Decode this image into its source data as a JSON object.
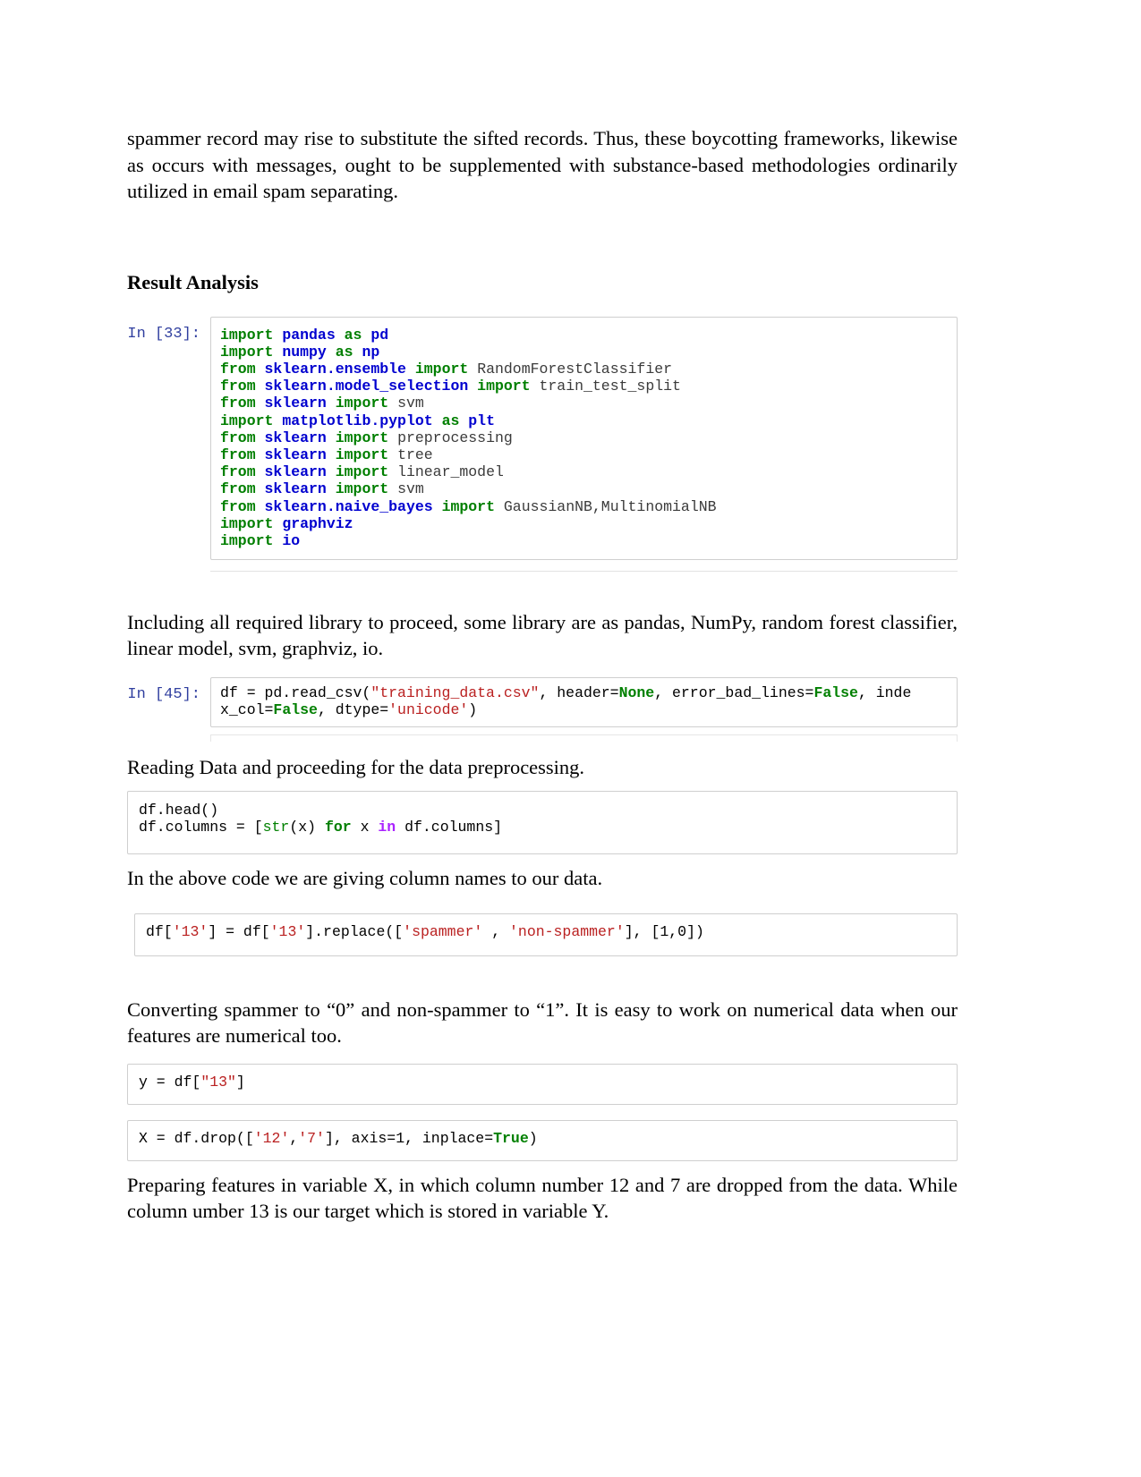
{
  "document": {
    "intro_paragraph": "spammer record may rise to substitute the sifted records. Thus, these boycotting frameworks, likewise as occurs with messages, ought to be supplemented with substance-based methodologies ordinarily utilized in email spam separating.",
    "section_heading": "Result Analysis",
    "paragraph_after_imports": "Including all required library to proceed, some library are as pandas, NumPy, random forest classifier, linear model, svm, graphviz, io.",
    "paragraph_after_readcsv": "Reading Data and proceeding for the data preprocessing.",
    "paragraph_after_columns": "In the above code we are giving column names to our data.",
    "paragraph_after_replace": "Converting spammer to “0” and non-spammer to “1”. It is easy to work on numerical data when our features are numerical too.",
    "paragraph_after_drop": "Preparing features in variable X, in which column number 12 and 7 are dropped from the data. While column umber 13 is our target which is stored in variable Y."
  },
  "cells": {
    "imports": {
      "prompt": "In [33]:",
      "lines": [
        "import pandas as pd",
        "import numpy as np",
        "from sklearn.ensemble import RandomForestClassifier",
        "from sklearn.model_selection import train_test_split",
        "from sklearn import svm",
        "import matplotlib.pyplot as plt",
        "from sklearn import preprocessing",
        "from sklearn import tree",
        "from sklearn import linear_model",
        "from sklearn import svm",
        "from sklearn.naive_bayes import GaussianNB,MultinomialNB",
        "import graphviz",
        "import io"
      ]
    },
    "read_csv": {
      "prompt": "In [45]:",
      "lines": [
        "df = pd.read_csv(\"training_data.csv\", header=None, error_bad_lines=False, index_col=False, dtype='unicode')"
      ]
    },
    "columns": {
      "prompt": "",
      "lines": [
        "df.head()",
        "df.columns = [str(x) for x in df.columns]"
      ]
    },
    "replace": {
      "prompt": "",
      "lines": [
        "df['13'] = df['13'].replace(['spammer' , 'non-spammer'], [1,0])"
      ]
    },
    "target": {
      "prompt": "",
      "lines": [
        "y = df[\"13\"]"
      ]
    },
    "drop": {
      "prompt": "",
      "lines": [
        "X = df.drop(['12','7'], axis=1, inplace=True)"
      ]
    }
  },
  "colors": {
    "keyword": "#007F00",
    "module": "#0000CF",
    "string": "#BA2121",
    "constant": "#008000",
    "operator": "#AA22FF",
    "prompt": "#303F9F",
    "cell_border": "#cfcfcf"
  }
}
